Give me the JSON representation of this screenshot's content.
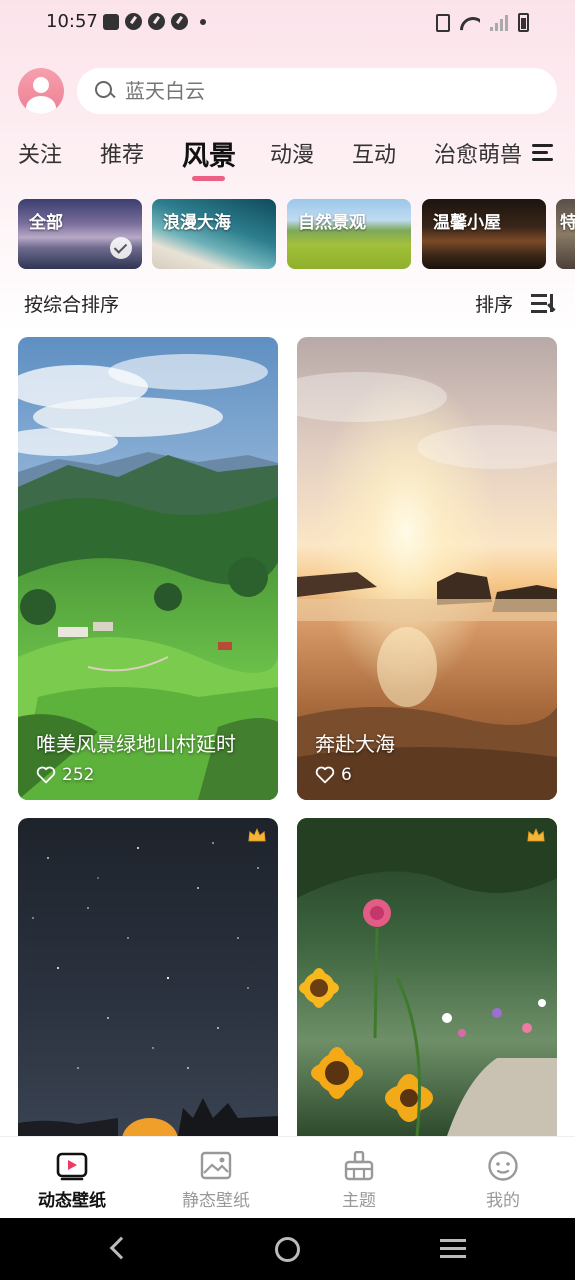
{
  "status_bar": {
    "time": "10:57"
  },
  "search": {
    "placeholder": "蓝天白云"
  },
  "tabs": [
    {
      "label": "关注",
      "active": false
    },
    {
      "label": "推荐",
      "active": false
    },
    {
      "label": "风景",
      "active": true
    },
    {
      "label": "动漫",
      "active": false
    },
    {
      "label": "互动",
      "active": false
    },
    {
      "label": "治愈萌兽",
      "active": false
    }
  ],
  "categories": [
    {
      "label": "全部",
      "selected": true
    },
    {
      "label": "浪漫大海",
      "selected": false
    },
    {
      "label": "自然景观",
      "selected": false
    },
    {
      "label": "温馨小屋",
      "selected": false
    },
    {
      "label": "特",
      "selected": false
    }
  ],
  "sort": {
    "left_label": "按综合排序",
    "right_label": "排序"
  },
  "cards": [
    {
      "title": "唯美风景绿地山村延时",
      "likes": "252",
      "premium": false
    },
    {
      "title": "奔赴大海",
      "likes": "6",
      "premium": false
    },
    {
      "title": "",
      "likes": "",
      "premium": true
    },
    {
      "title": "",
      "likes": "",
      "premium": true
    }
  ],
  "bottom_nav": [
    {
      "label": "动态壁纸",
      "icon": "play-icon",
      "active": true
    },
    {
      "label": "静态壁纸",
      "icon": "image-icon",
      "active": false
    },
    {
      "label": "主题",
      "icon": "brush-icon",
      "active": false
    },
    {
      "label": "我的",
      "icon": "face-icon",
      "active": false
    }
  ],
  "colors": {
    "accent": "#ee5f86",
    "active_text": "#111111",
    "inactive_text": "#999999"
  }
}
